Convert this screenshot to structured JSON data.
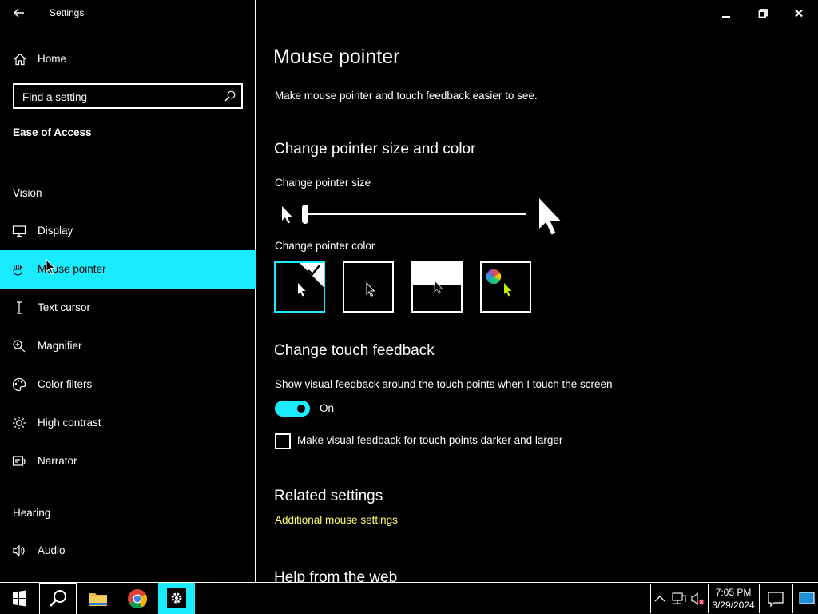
{
  "window": {
    "app_title": "Settings"
  },
  "sidebar": {
    "home_label": "Home",
    "search": {
      "placeholder": "Find a setting",
      "value": ""
    },
    "section_title": "Ease of Access",
    "groups": [
      {
        "label": "Vision",
        "items": [
          {
            "label": "Display",
            "icon": "display-icon"
          },
          {
            "label": "Mouse pointer",
            "icon": "mouse-pointer-icon",
            "selected": true
          },
          {
            "label": "Text cursor",
            "icon": "text-cursor-icon"
          },
          {
            "label": "Magnifier",
            "icon": "magnifier-icon"
          },
          {
            "label": "Color filters",
            "icon": "color-filters-icon"
          },
          {
            "label": "High contrast",
            "icon": "high-contrast-icon"
          },
          {
            "label": "Narrator",
            "icon": "narrator-icon"
          }
        ]
      },
      {
        "label": "Hearing",
        "items": [
          {
            "label": "Audio",
            "icon": "audio-icon"
          }
        ]
      }
    ]
  },
  "main": {
    "title": "Mouse pointer",
    "description": "Make mouse pointer and touch feedback easier to see.",
    "pointer_section": {
      "heading": "Change pointer size and color",
      "size_label": "Change pointer size",
      "size_level": 0.0,
      "color_label": "Change pointer color",
      "color_options": [
        {
          "name": "white",
          "selected": true
        },
        {
          "name": "black",
          "selected": false
        },
        {
          "name": "inverted",
          "selected": false
        },
        {
          "name": "custom",
          "selected": false
        }
      ]
    },
    "touch_section": {
      "heading": "Change touch feedback",
      "toggle_label": "Show visual feedback around the touch points when I touch the screen",
      "toggle_state": "On",
      "checkbox_label": "Make visual feedback for touch points darker and larger",
      "checkbox_checked": false
    },
    "related": {
      "heading": "Related settings",
      "link": "Additional mouse settings"
    },
    "help": {
      "heading": "Help from the web"
    }
  },
  "taskbar": {
    "apps": [
      "start-icon",
      "search-icon",
      "file-explorer-icon",
      "chrome-icon",
      "settings-icon"
    ],
    "clock_time": "7:05 PM",
    "clock_date": "3/29/2024"
  },
  "colors": {
    "accent": "#1aebff",
    "link": "#ffff66",
    "background": "#000000",
    "foreground": "#ffffff"
  }
}
